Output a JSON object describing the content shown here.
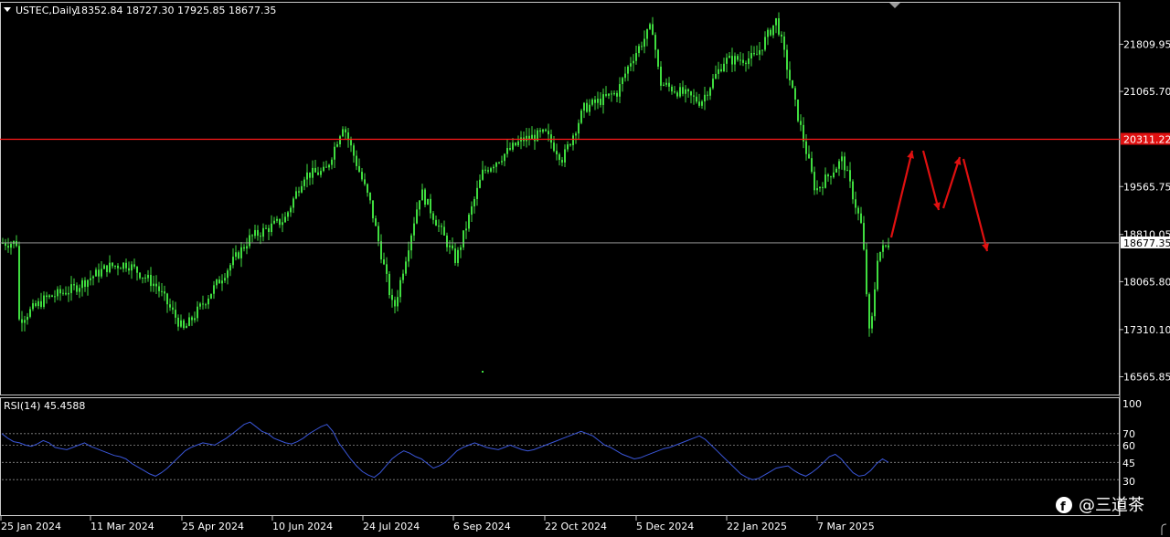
{
  "header": {
    "symbol_label": "USTEC,Daily",
    "ohlc_text": "18352.84 18727.30 17925.85 18677.35"
  },
  "rsi": {
    "label": "RSI(14) 45.4588",
    "levels": [
      "100",
      "70",
      "60",
      "45",
      "30"
    ]
  },
  "watermark": {
    "text": "@三道茶"
  },
  "colors": {
    "background": "#000000",
    "candle": "#3fdc3f",
    "resistance": "#ff1a1a",
    "current_line": "#aaaaaa",
    "rsi_line": "#3a56d8",
    "forecast_arrow": "#e01010",
    "frame": "#c8c8c8"
  },
  "chart_data": [
    {
      "type": "candlestick",
      "title": "USTEC,Daily",
      "y_ticks": [
        "21809.95",
        "21065.70",
        "19565.75",
        "18810.05",
        "18065.80",
        "17310.10",
        "16565.85"
      ],
      "x_ticks": [
        "25 Jan 2024",
        "11 Mar 2024",
        "25 Apr 2024",
        "10 Jun 2024",
        "24 Jul 2024",
        "6 Sep 2024",
        "22 Oct 2024",
        "5 Dec 2024",
        "22 Jan 2025",
        "7 Mar 2025"
      ],
      "ylim": [
        16300,
        22450
      ],
      "resistance_label": "20311.22",
      "resistance_value": 20311.22,
      "current_label": "18677.35",
      "current_value": 18677.35,
      "close_path": [
        {
          "date": "2024-01-25",
          "close": 17450
        },
        {
          "date": "2024-02-08",
          "close": 17800
        },
        {
          "date": "2024-02-22",
          "close": 17950
        },
        {
          "date": "2024-03-11",
          "close": 18300
        },
        {
          "date": "2024-03-21",
          "close": 18350
        },
        {
          "date": "2024-04-05",
          "close": 18000
        },
        {
          "date": "2024-04-19",
          "close": 17300
        },
        {
          "date": "2024-04-25",
          "close": 17550
        },
        {
          "date": "2024-05-10",
          "close": 18200
        },
        {
          "date": "2024-05-23",
          "close": 18750
        },
        {
          "date": "2024-06-10",
          "close": 19050
        },
        {
          "date": "2024-06-20",
          "close": 19750
        },
        {
          "date": "2024-07-01",
          "close": 19800
        },
        {
          "date": "2024-07-10",
          "close": 20550
        },
        {
          "date": "2024-07-24",
          "close": 19300
        },
        {
          "date": "2024-08-05",
          "close": 17600
        },
        {
          "date": "2024-08-19",
          "close": 19500
        },
        {
          "date": "2024-09-06",
          "close": 18400
        },
        {
          "date": "2024-09-20",
          "close": 19800
        },
        {
          "date": "2024-10-10",
          "close": 20300
        },
        {
          "date": "2024-10-22",
          "close": 20400
        },
        {
          "date": "2024-10-31",
          "close": 20000
        },
        {
          "date": "2024-11-11",
          "close": 20800
        },
        {
          "date": "2024-11-28",
          "close": 21050
        },
        {
          "date": "2024-12-05",
          "close": 21550
        },
        {
          "date": "2024-12-16",
          "close": 22100
        },
        {
          "date": "2024-12-20",
          "close": 21200
        },
        {
          "date": "2025-01-10",
          "close": 20900
        },
        {
          "date": "2025-01-22",
          "close": 21550
        },
        {
          "date": "2025-02-07",
          "close": 21600
        },
        {
          "date": "2025-02-18",
          "close": 22200
        },
        {
          "date": "2025-02-28",
          "close": 20800
        },
        {
          "date": "2025-03-10",
          "close": 19500
        },
        {
          "date": "2025-03-24",
          "close": 20000
        },
        {
          "date": "2025-04-03",
          "close": 18900
        },
        {
          "date": "2025-04-07",
          "close": 17100
        },
        {
          "date": "2025-04-11",
          "close": 18500
        },
        {
          "date": "2025-04-17",
          "close": 18677.35
        }
      ]
    },
    {
      "type": "line",
      "title": "RSI(14) 45.4588",
      "ylim": [
        0,
        100
      ],
      "levels": [
        70,
        60,
        45,
        30
      ],
      "values": [
        70,
        66,
        63,
        62,
        60,
        59,
        61,
        64,
        62,
        58,
        57,
        56,
        58,
        60,
        62,
        59,
        57,
        55,
        53,
        51,
        50,
        48,
        44,
        41,
        38,
        35,
        33,
        36,
        40,
        45,
        50,
        55,
        58,
        60,
        62,
        61,
        60,
        63,
        66,
        70,
        74,
        78,
        80,
        76,
        72,
        70,
        66,
        64,
        62,
        61,
        63,
        66,
        70,
        73,
        76,
        78,
        72,
        62,
        55,
        48,
        42,
        37,
        34,
        32,
        36,
        42,
        48,
        52,
        55,
        53,
        50,
        48,
        44,
        40,
        42,
        45,
        50,
        55,
        58,
        60,
        62,
        60,
        58,
        57,
        56,
        58,
        60,
        58,
        56,
        55,
        56,
        58,
        60,
        62,
        64,
        66,
        68,
        70,
        72,
        70,
        68,
        64,
        60,
        58,
        55,
        52,
        50,
        48,
        49,
        51,
        53,
        55,
        57,
        58,
        60,
        62,
        64,
        66,
        68,
        65,
        60,
        55,
        50,
        45,
        40,
        35,
        32,
        30,
        31,
        34,
        37,
        40,
        41,
        42,
        38,
        35,
        33,
        36,
        40,
        45,
        50,
        52,
        48,
        42,
        36,
        33,
        34,
        38,
        44,
        48,
        45
      ]
    }
  ]
}
